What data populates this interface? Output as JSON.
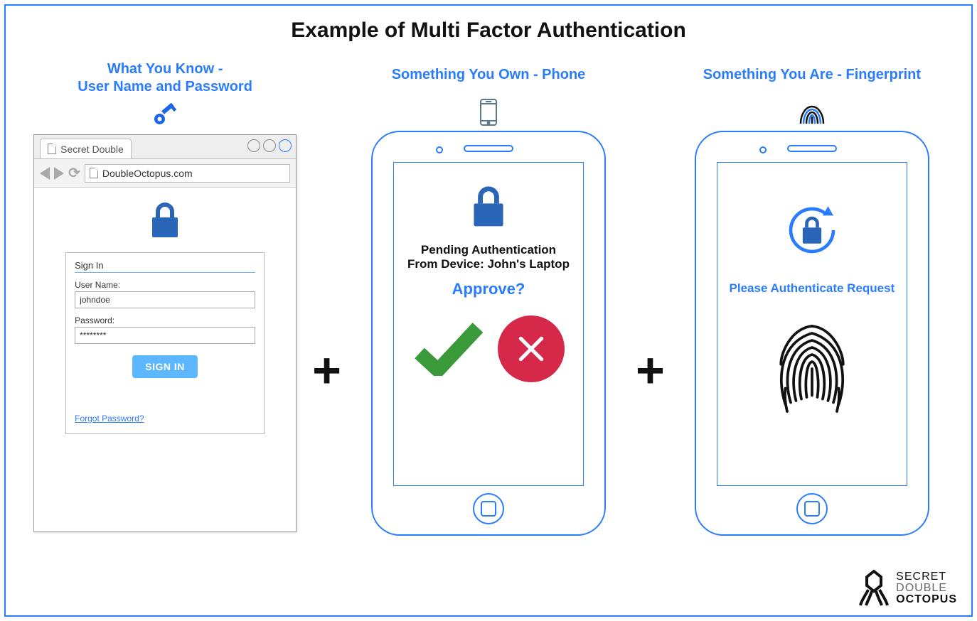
{
  "title": "Example of Multi Factor Authentication",
  "col1": {
    "heading_l1": "What You Know -",
    "heading_l2": "User Name and Password",
    "tab_title": "Secret Double",
    "url": "DoubleOctopus.com",
    "signin_title": "Sign In",
    "user_label": "User Name:",
    "user_value": "johndoe",
    "pass_label": "Password:",
    "pass_value": "********",
    "signin_btn": "SIGN IN",
    "forgot": "Forgot Password?"
  },
  "col2": {
    "heading": "Something You Own - Phone",
    "pending_l1": "Pending Authentication",
    "pending_l2": "From Device: John's Laptop",
    "approve": "Approve?"
  },
  "col3": {
    "heading": "Something You Are - Fingerprint",
    "auth_msg": "Please Authenticate Request"
  },
  "brand": {
    "l1": "SECRET",
    "l2": "DOUBLE",
    "l3": "OCTOPUS"
  }
}
